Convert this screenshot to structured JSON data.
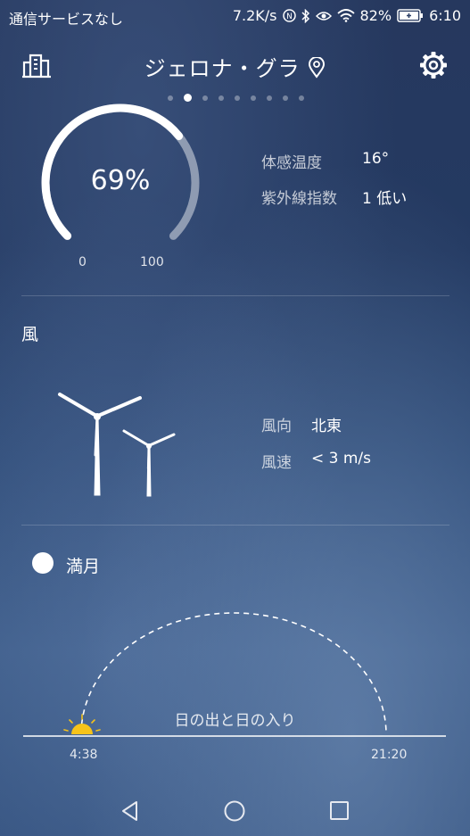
{
  "status_bar": {
    "carrier": "通信サービスなし",
    "speed": "7.2K/s",
    "battery": "82%",
    "time": "6:10"
  },
  "header": {
    "title": "ジェロナ・グラ",
    "page_count": 9,
    "active_page": 1
  },
  "humidity": {
    "value": "69%",
    "fraction": 0.69,
    "min_label": "0",
    "max_label": "100"
  },
  "details": {
    "feels_like_label": "体感温度",
    "feels_like_value": "16°",
    "uv_label": "紫外線指数",
    "uv_value": "1 低い"
  },
  "wind": {
    "title": "風",
    "direction_label": "風向",
    "direction_value": "北東",
    "speed_label": "風速",
    "speed_value": "< 3 m/s"
  },
  "moon": {
    "phase": "満月"
  },
  "sun": {
    "label": "日の出と日の入り",
    "sunrise": "4:38",
    "sunset": "21:20",
    "progress": 0.0
  },
  "colors": {
    "sun": "#f6c31a",
    "gauge_track": "rgba(255,255,255,0.45)",
    "gauge_fill": "#ffffff"
  }
}
